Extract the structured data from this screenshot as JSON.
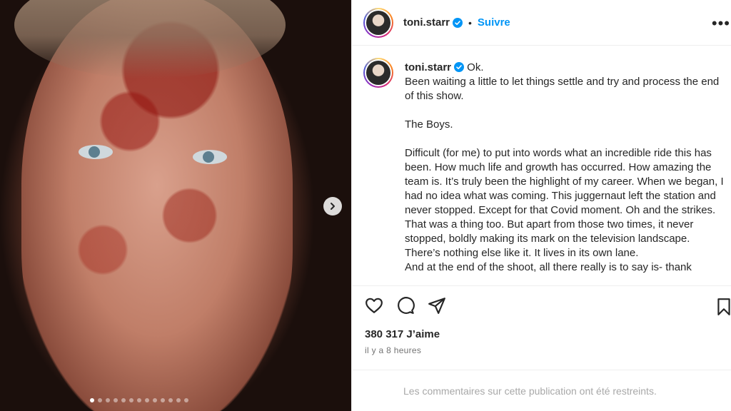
{
  "post": {
    "username": "toni.starr",
    "follow_label": "Suivre",
    "separator": "•",
    "more_label": "•••",
    "carousel": {
      "total_slides": 13,
      "active_index": 0
    }
  },
  "caption": {
    "username": "toni.starr",
    "text": " Ok.\nBeen waiting a little to let things settle and try and process the end of this show.\n\nThe Boys.\n\nDifficult (for me) to put into words what an incredible ride this has been. How much life and growth has occurred. How amazing the team is. It’s truly been the highlight of my career. When we began, I had no idea what was coming. This juggernaut left the station and never stopped. Except for that Covid moment. Oh and the strikes. That was a thing too. But apart from those two times, it never stopped, boldly making its mark on the television landscape. There’s nothing else like it. It lives in its own lane.\nAnd at the end of the shoot, all there really is to say is- thank"
  },
  "stats": {
    "likes": "380 317 J’aime",
    "time_ago": "il y a 8 heures"
  },
  "comments": {
    "restricted_text": "Les commentaires sur cette publication ont été restreints."
  },
  "icons": {
    "like": "heart-icon",
    "comment": "comment-bubble-icon",
    "share": "paper-plane-icon",
    "save": "bookmark-icon",
    "verified": "verified-badge-icon",
    "next": "chevron-right-icon"
  },
  "colors": {
    "accent": "#0095f6",
    "text": "#262626",
    "muted": "#737373",
    "restricted": "#a8a8a8"
  }
}
